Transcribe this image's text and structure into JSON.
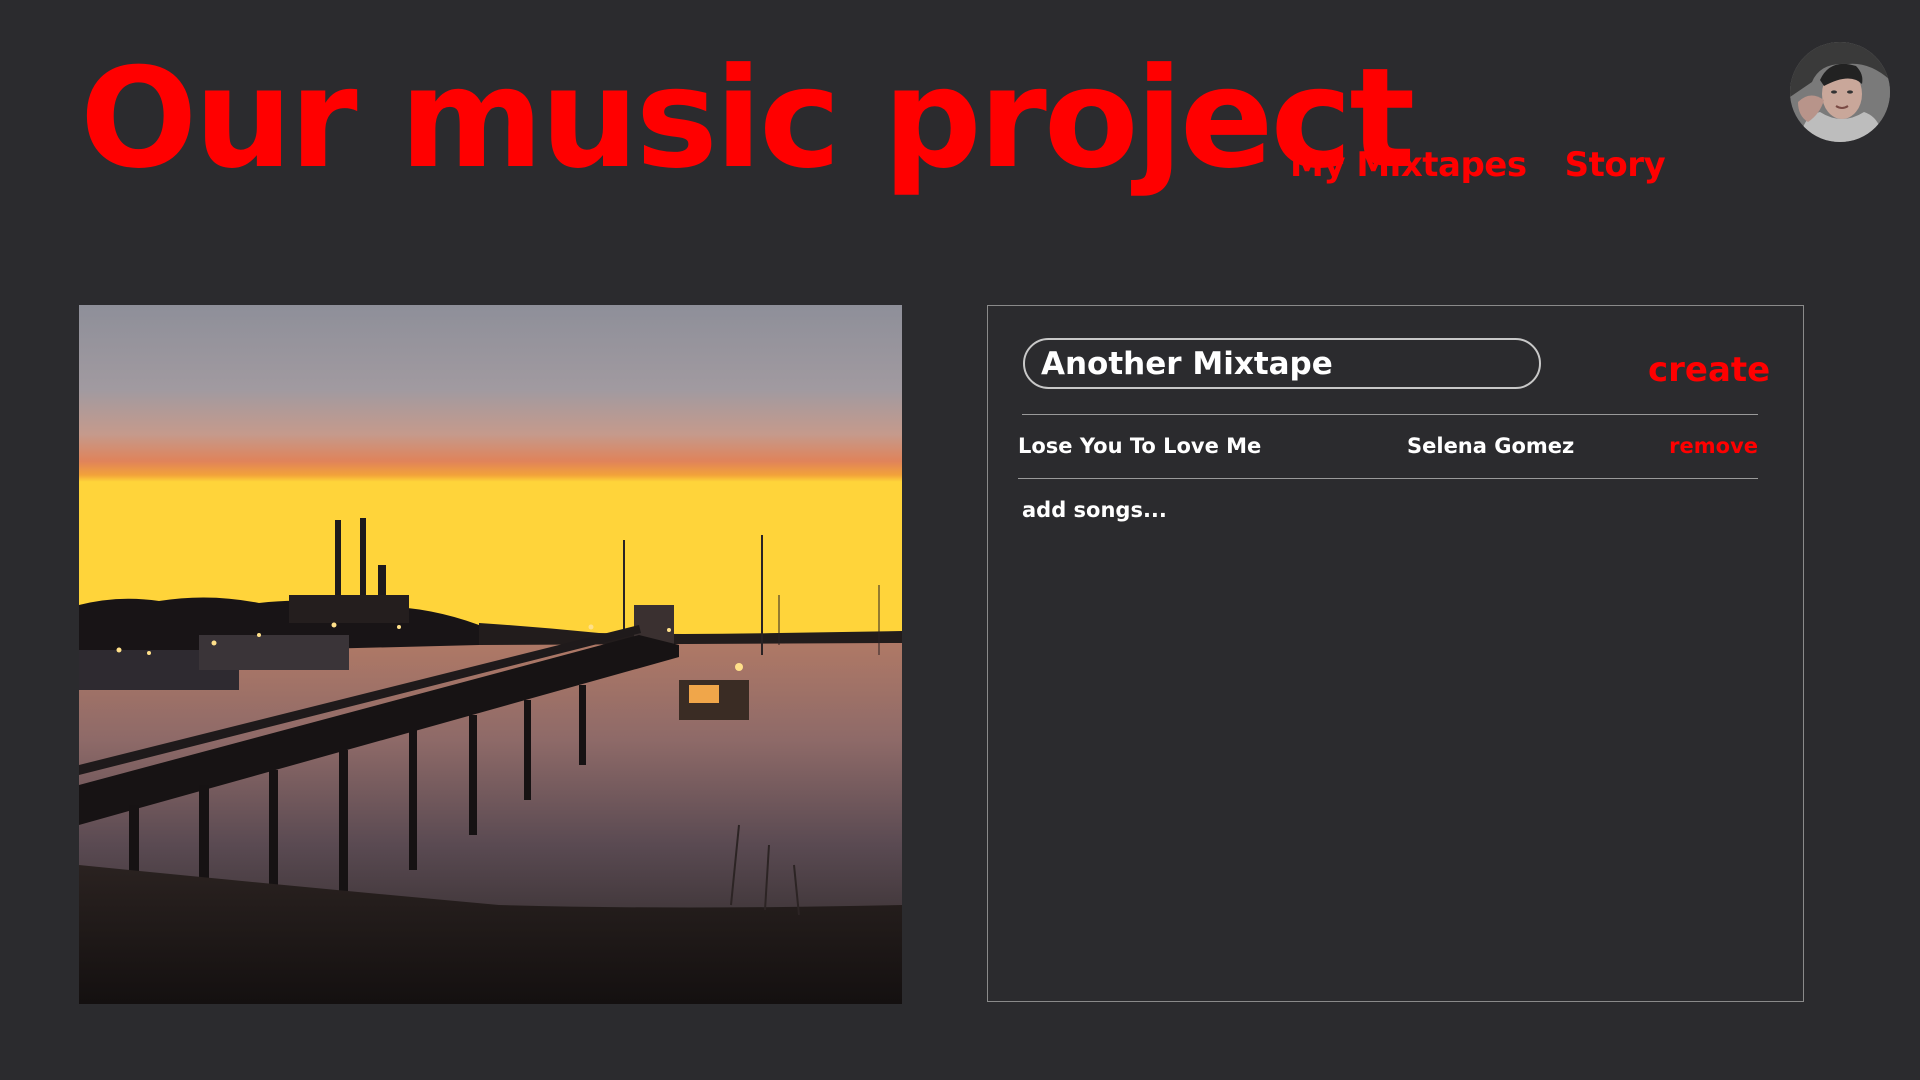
{
  "header": {
    "title": "Our music project",
    "nav": [
      {
        "label": "My Mixtapes"
      },
      {
        "label": "Story"
      }
    ],
    "avatar_icon": "user-avatar"
  },
  "cover": {
    "icon": "sunset-harbor-photo"
  },
  "mixtape": {
    "name_value": "Another Mixtape",
    "create_label": "create",
    "songs": [
      {
        "title": "Lose You To Love Me",
        "artist": "Selena Gomez",
        "remove_label": "remove"
      }
    ],
    "add_songs_label": "add songs..."
  },
  "colors": {
    "background": "#2b2b2e",
    "accent": "#ff0000",
    "text": "#ffffff"
  }
}
